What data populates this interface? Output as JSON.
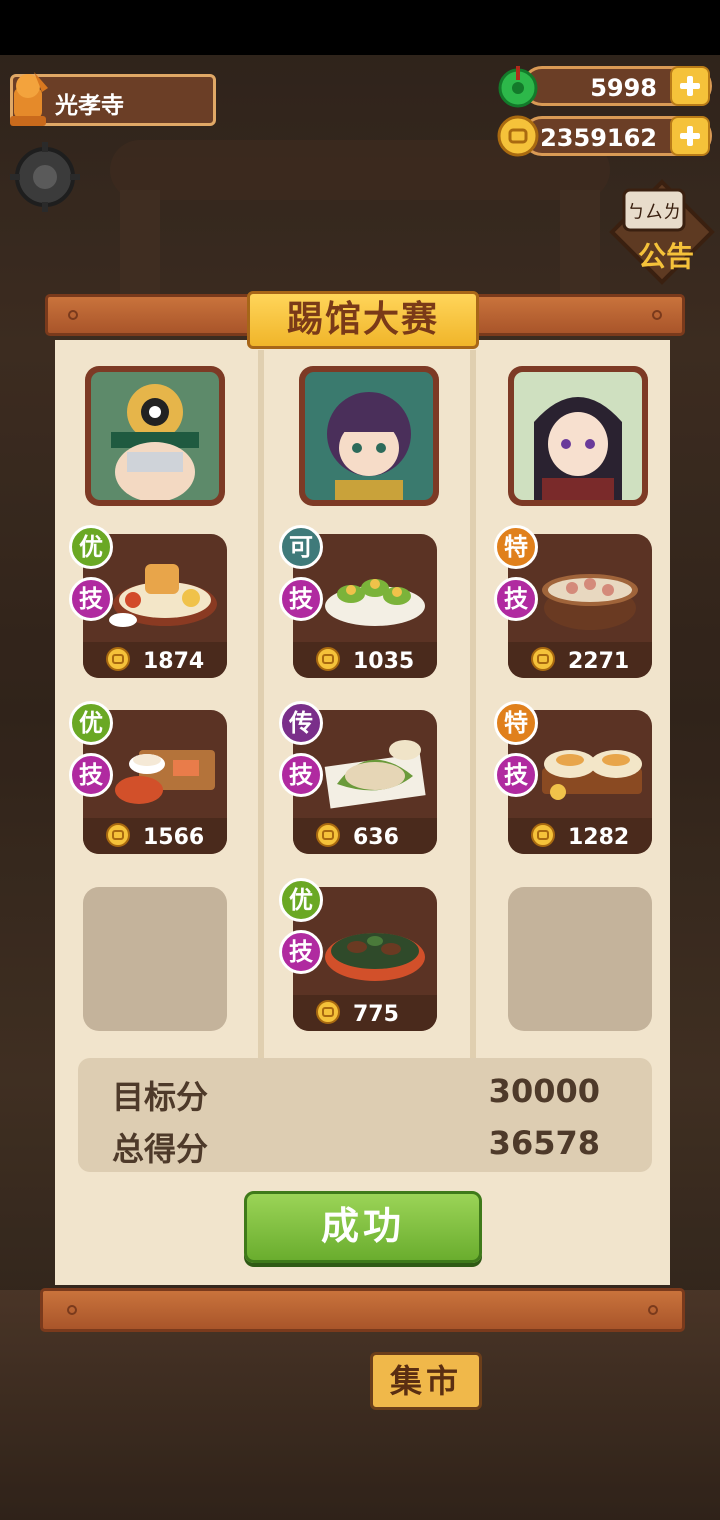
{
  "player": {
    "name": "光孝寺"
  },
  "resources": {
    "jade": "5998",
    "coins": "2359162"
  },
  "notice": {
    "label": "公告",
    "bubble": "ㄅㄙㄌ"
  },
  "dialog": {
    "title": "踢馆大赛"
  },
  "columns": [
    {
      "dishes": [
        {
          "grade": "优",
          "skill": "技",
          "score": "1874"
        },
        {
          "grade": "优",
          "skill": "技",
          "score": "1566"
        }
      ]
    },
    {
      "dishes": [
        {
          "grade": "可",
          "skill": "技",
          "score": "1035"
        },
        {
          "grade": "传",
          "skill": "技",
          "score": "636"
        },
        {
          "grade": "优",
          "skill": "技",
          "score": "775"
        }
      ]
    },
    {
      "dishes": [
        {
          "grade": "特",
          "skill": "技",
          "score": "2271"
        },
        {
          "grade": "特",
          "skill": "技",
          "score": "1282"
        }
      ]
    }
  ],
  "summary": {
    "target_label": "目标分",
    "target_value": "30000",
    "total_label": "总得分",
    "total_value": "36578"
  },
  "result_button": "成功",
  "market_sign": "集市",
  "colors": {
    "grade_you": "#6aa824",
    "grade_ke": "#3f7a7a",
    "grade_chuan": "#7a2f8a",
    "grade_te": "#e0801c",
    "skill": "#b02aa0"
  }
}
